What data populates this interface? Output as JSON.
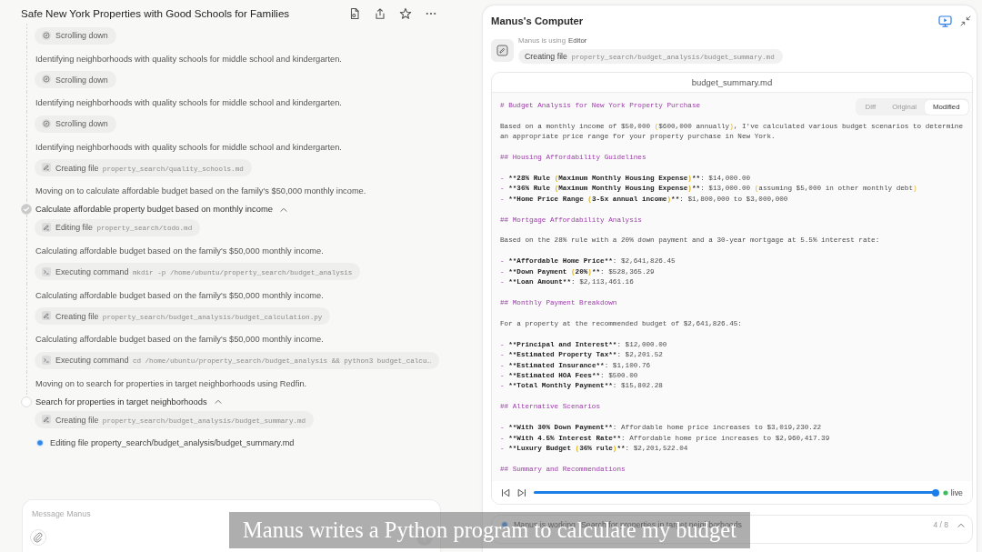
{
  "task": {
    "title": "Safe New York Properties with Good Schools for Families",
    "log": [
      {
        "kind": "browse",
        "verb": "Scrolling down"
      },
      {
        "kind": "note",
        "text": "Identifying neighborhoods with quality schools for middle school and kindergarten."
      },
      {
        "kind": "browse",
        "verb": "Scrolling down"
      },
      {
        "kind": "note",
        "text": "Identifying neighborhoods with quality schools for middle school and kindergarten."
      },
      {
        "kind": "browse",
        "verb": "Scrolling down"
      },
      {
        "kind": "note",
        "text": "Identifying neighborhoods with quality schools for middle school and kindergarten."
      },
      {
        "kind": "edit",
        "verb": "Creating file",
        "target": "property_search/quality_schools.md"
      },
      {
        "kind": "note",
        "text": "Moving on to calculate affordable budget based on the family's $50,000 monthly income."
      },
      {
        "kind": "step",
        "title": "Calculate affordable property budget based on monthly income",
        "done": true,
        "expanded": true
      },
      {
        "kind": "edit",
        "verb": "Editing file",
        "target": "property_search/todo.md"
      },
      {
        "kind": "note",
        "text": "Calculating affordable budget based on the family's $50,000 monthly income."
      },
      {
        "kind": "command",
        "verb": "Executing command",
        "target": "mkdir -p /home/ubuntu/property_search/budget_analysis"
      },
      {
        "kind": "note",
        "text": "Calculating affordable budget based on the family's $50,000 monthly income."
      },
      {
        "kind": "edit",
        "verb": "Creating file",
        "target": "property_search/budget_analysis/budget_calculation.py"
      },
      {
        "kind": "note",
        "text": "Calculating affordable budget based on the family's $50,000 monthly income."
      },
      {
        "kind": "command",
        "verb": "Executing command",
        "target": "cd /home/ubuntu/property_search/budget_analysis && python3 budget_calcu…"
      },
      {
        "kind": "note",
        "text": "Moving on to search for properties in target neighborhoods using Redfin."
      },
      {
        "kind": "step",
        "title": "Search for properties in target neighborhoods",
        "done": false,
        "expanded": true
      },
      {
        "kind": "edit",
        "verb": "Creating file",
        "target": "property_search/budget_analysis/budget_summary.md"
      },
      {
        "kind": "live",
        "text": "Editing file property_search/budget_analysis/budget_summary.md"
      }
    ],
    "composer": {
      "placeholder": "Message Manus"
    }
  },
  "computer": {
    "title": "Manus's Computer",
    "tool_status": {
      "prefix": "Manus is using",
      "tool": "Editor"
    },
    "action": {
      "verb": "Creating file",
      "target": "property_search/budget_analysis/budget_summary.md"
    },
    "editor": {
      "filename": "budget_summary.md",
      "view_tabs": [
        {
          "label": "Diff",
          "selected": false
        },
        {
          "label": "Original",
          "selected": false
        },
        {
          "label": "Modified",
          "selected": true
        }
      ],
      "blocks": [
        [
          {
            "kind": "heading",
            "text": "# Budget Analysis for New York Property Purchase"
          }
        ],
        [
          {
            "kind": "text",
            "text": "Based on a monthly income of $50,000 ($600,000 annually), I've calculated various budget scenarios to determine"
          },
          {
            "kind": "text",
            "text": "an appropriate price range for your property purchase in New York."
          }
        ],
        [
          {
            "kind": "heading",
            "text": "## Housing Affordability Guidelines"
          }
        ],
        [
          {
            "kind": "bullet",
            "text": "- **28% Rule (Maximum Monthly Housing Expense)**: $14,000.00"
          },
          {
            "kind": "bullet",
            "text": "- **36% Rule (Maximum Monthly Housing Expense)**: $13,000.00 (assuming $5,000 in other monthly debt)"
          },
          {
            "kind": "bullet",
            "text": "- **Home Price Range (3-5x annual income)**: $1,800,000 to $3,000,000"
          }
        ],
        [
          {
            "kind": "heading",
            "text": "## Mortgage Affordability Analysis"
          }
        ],
        [
          {
            "kind": "text",
            "text": "Based on the 28% rule with a 20% down payment and a 30-year mortgage at 5.5% interest rate:"
          }
        ],
        [
          {
            "kind": "bullet",
            "text": "- **Affordable Home Price**: $2,641,826.45"
          },
          {
            "kind": "bullet",
            "text": "- **Down Payment (20%)**: $528,365.29"
          },
          {
            "kind": "bullet",
            "text": "- **Loan Amount**: $2,113,461.16"
          }
        ],
        [
          {
            "kind": "heading",
            "text": "## Monthly Payment Breakdown"
          }
        ],
        [
          {
            "kind": "text",
            "text": "For a property at the recommended budget of $2,641,826.45:"
          }
        ],
        [
          {
            "kind": "bullet",
            "text": "- **Principal and Interest**: $12,000.00"
          },
          {
            "kind": "bullet",
            "text": "- **Estimated Property Tax**: $2,201.52"
          },
          {
            "kind": "bullet",
            "text": "- **Estimated Insurance**: $1,100.76"
          },
          {
            "kind": "bullet",
            "text": "- **Estimated HOA Fees**: $500.00"
          },
          {
            "kind": "bullet",
            "text": "- **Total Monthly Payment**: $15,802.28"
          }
        ],
        [
          {
            "kind": "heading",
            "text": "## Alternative Scenarios"
          }
        ],
        [
          {
            "kind": "bullet",
            "text": "- **With 30% Down Payment**: Affordable home price increases to $3,019,230.22"
          },
          {
            "kind": "bullet",
            "text": "- **With 4.5% Interest Rate**: Affordable home price increases to $2,960,417.39"
          },
          {
            "kind": "bullet",
            "text": "- **Luxury Budget (36% rule)**: $2,201,522.04"
          }
        ],
        [
          {
            "kind": "heading",
            "text": "## Summary and Recommendations"
          }
        ]
      ]
    },
    "player": {
      "level": 1,
      "live_label": "live"
    },
    "status": {
      "label": "Manus is working",
      "task": "Search for properties in target neighborhoods",
      "progress": "4 / 8"
    }
  },
  "caption": "Manus writes a Python program to calculate my budget"
}
